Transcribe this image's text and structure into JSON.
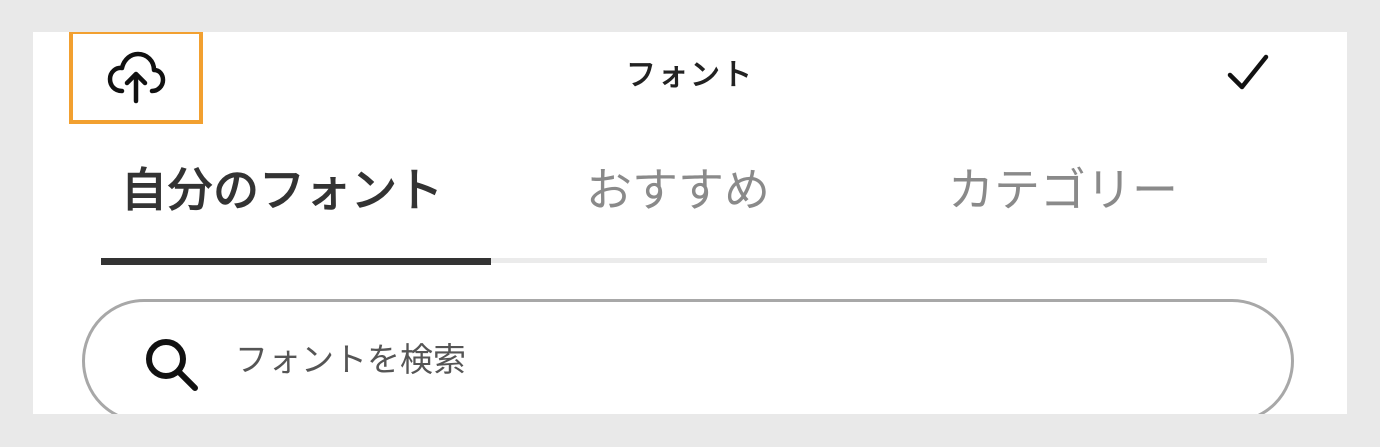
{
  "header": {
    "title": "フォント",
    "upload_icon": "cloud-upload-icon",
    "done_icon": "check-icon",
    "highlight_color": "#f2a030"
  },
  "tabs": [
    {
      "label": "自分のフォント",
      "active": true
    },
    {
      "label": "おすすめ",
      "active": false
    },
    {
      "label": "カテゴリー",
      "active": false
    }
  ],
  "search": {
    "placeholder": "フォントを検索",
    "value": "",
    "icon": "search-icon"
  }
}
